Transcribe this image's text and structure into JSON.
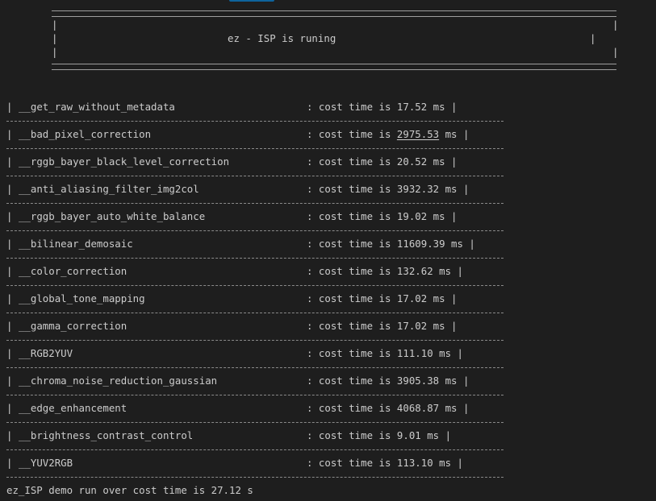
{
  "banner": {
    "border_line": "=====================================================================================================",
    "title": "ez - ISP is runing"
  },
  "rows": [
    {
      "name": "__get_raw_without_metadata",
      "prefix": ": cost time is ",
      "value": "17.52",
      "unit": " ms |"
    },
    {
      "name": "__bad_pixel_correction",
      "prefix": ": cost time is ",
      "value": "2975.53",
      "unit": " ms |"
    },
    {
      "name": "__rggb_bayer_black_level_correction",
      "prefix": ": cost time is ",
      "value": "20.52",
      "unit": " ms |"
    },
    {
      "name": "__anti_aliasing_filter_img2col",
      "prefix": ": cost time is ",
      "value": "3932.32",
      "unit": " ms |"
    },
    {
      "name": "__rggb_bayer_auto_white_balance",
      "prefix": ": cost time is ",
      "value": "19.02",
      "unit": " ms |"
    },
    {
      "name": "__bilinear_demosaic",
      "prefix": ": cost time is ",
      "value": "11609.39",
      "unit": " ms |"
    },
    {
      "name": "__color_correction",
      "prefix": ": cost time is ",
      "value": "132.62",
      "unit": " ms |"
    },
    {
      "name": "__global_tone_mapping",
      "prefix": ": cost time is ",
      "value": "17.02",
      "unit": " ms |"
    },
    {
      "name": "__gamma_correction",
      "prefix": ": cost time is ",
      "value": "17.02",
      "unit": " ms |"
    },
    {
      "name": "__RGB2YUV",
      "prefix": ": cost time is ",
      "value": "111.10",
      "unit": " ms |"
    },
    {
      "name": "__chroma_noise_reduction_gaussian",
      "prefix": ": cost time is ",
      "value": "3905.38",
      "unit": " ms |"
    },
    {
      "name": "__edge_enhancement",
      "prefix": ": cost time is ",
      "value": "4068.87",
      "unit": " ms |"
    },
    {
      "name": "__brightness_contrast_control",
      "prefix": ": cost time is ",
      "value": "9.01",
      "unit": " ms |"
    },
    {
      "name": "__YUV2RGB",
      "prefix": ": cost time is ",
      "value": "113.10",
      "unit": " ms |"
    }
  ],
  "row_pipe": "|",
  "summary": "ez_ISP demo run over cost time is 27.12 s"
}
